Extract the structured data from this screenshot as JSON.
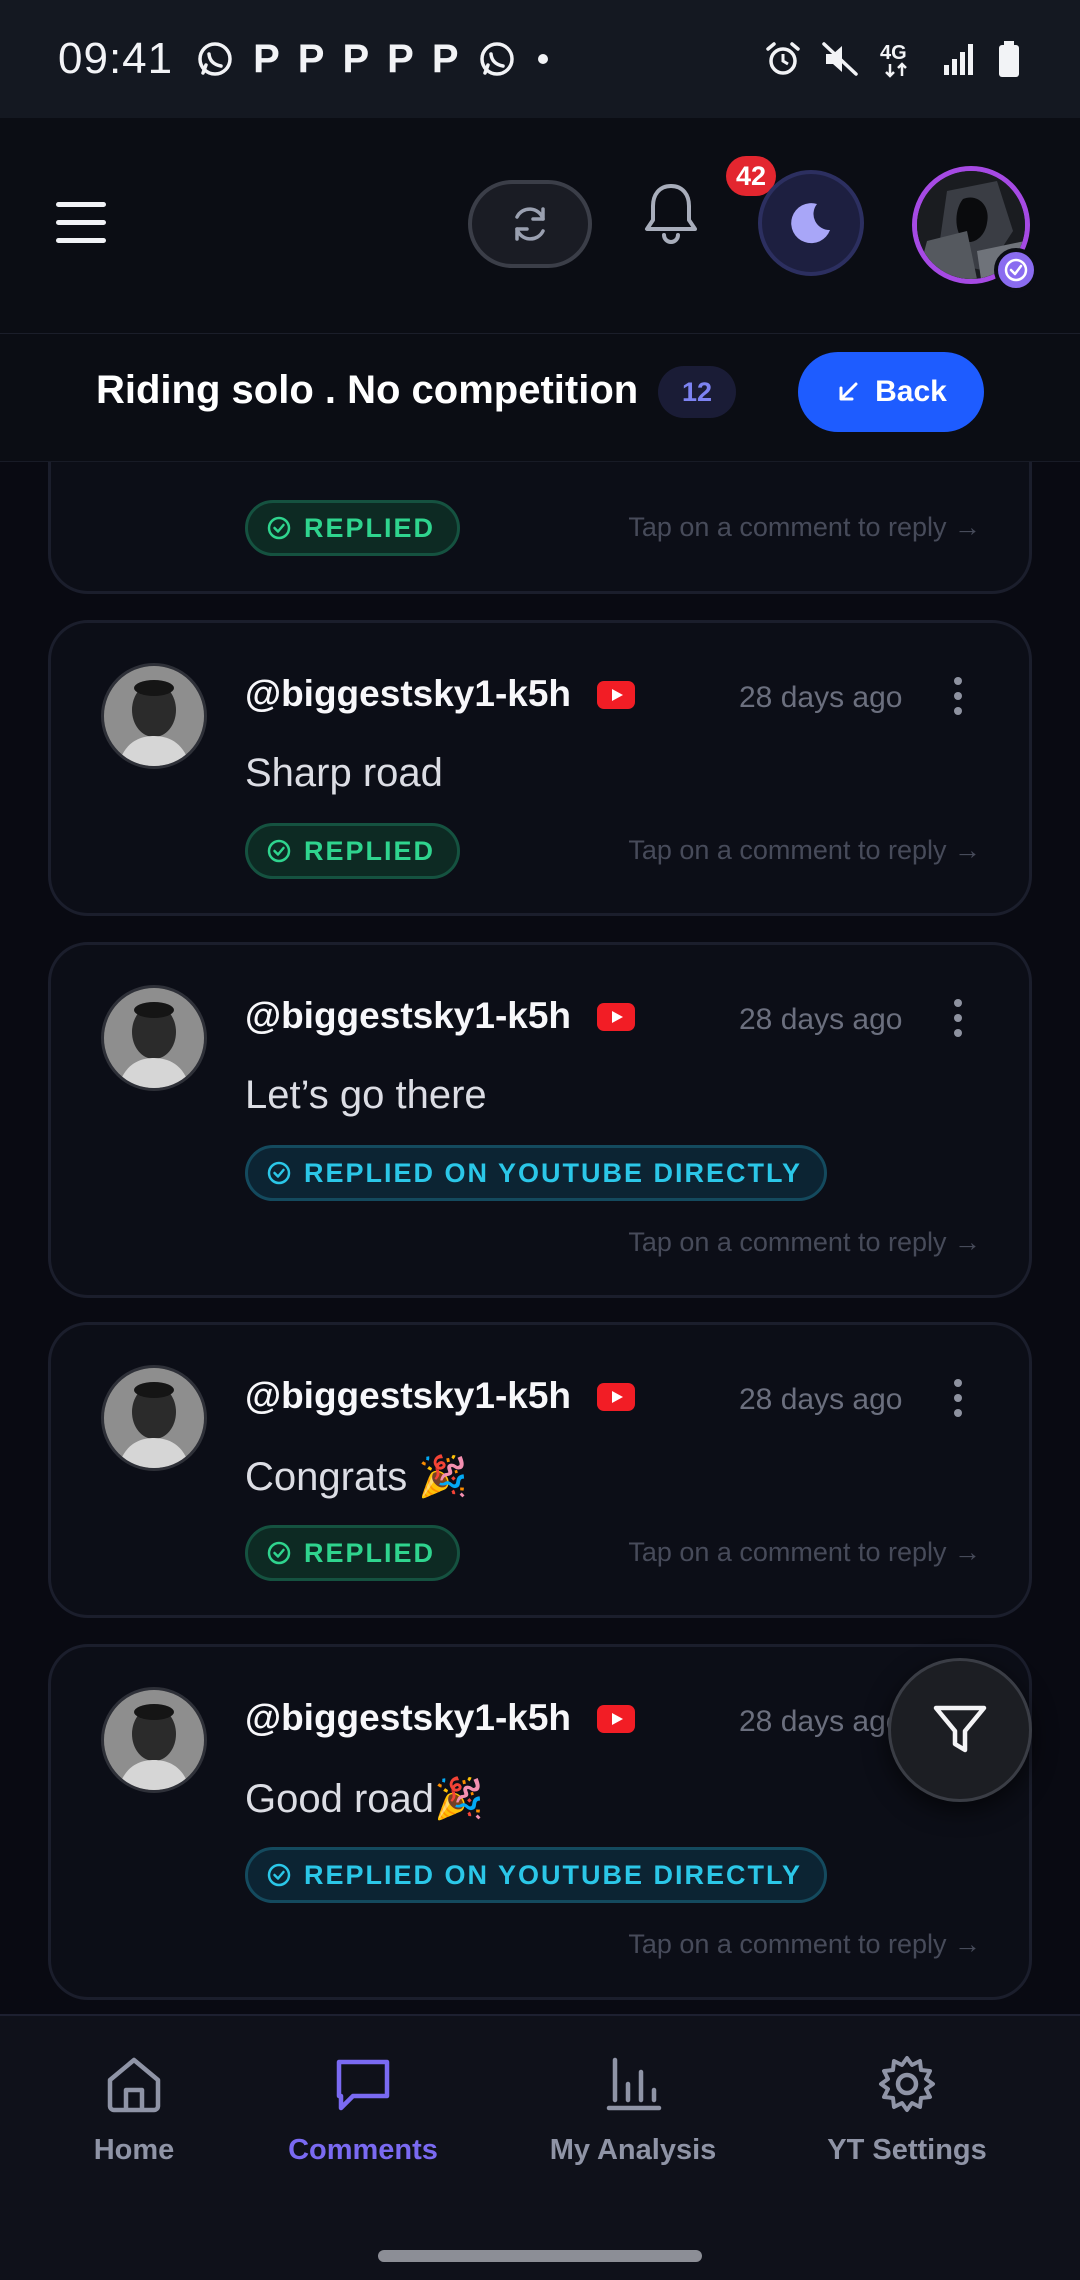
{
  "status_bar": {
    "time": "09:41",
    "notification_icons": [
      "whatsapp-icon",
      "p-icon",
      "p-icon",
      "p-icon",
      "p-icon",
      "p-icon",
      "whatsapp-icon",
      "dot-icon"
    ],
    "right_icons": [
      "alarm-icon",
      "mute-icon",
      "4g-icon",
      "signal-icon",
      "battery-icon"
    ],
    "p_glyph": "P",
    "network_label": "4G"
  },
  "header": {
    "notification_count": "42",
    "accent_purple": "#a64ae4"
  },
  "title_bar": {
    "title": "Riding solo . No competition",
    "count": "12",
    "back_label": "Back"
  },
  "partial_card": {
    "status": "REPLIED",
    "hint": "Tap on a comment to reply →"
  },
  "comments": [
    {
      "username": "@biggestsky1-k5h",
      "time": "28 days ago",
      "text": "Sharp road",
      "status": "REPLIED",
      "status_type": "replied",
      "hint": "Tap on a comment to reply →"
    },
    {
      "username": "@biggestsky1-k5h",
      "time": "28 days ago",
      "text": "Let’s go there",
      "status": "REPLIED ON YOUTUBE DIRECTLY",
      "status_type": "youtube",
      "hint": "Tap on a comment to reply →"
    },
    {
      "username": "@biggestsky1-k5h",
      "time": "28 days ago",
      "text": "Congrats 🎉",
      "status": "REPLIED",
      "status_type": "replied",
      "hint": "Tap on a comment to reply →"
    },
    {
      "username": "@biggestsky1-k5h",
      "time": "28 days ago",
      "text": "Good road🎉",
      "status": "REPLIED ON YOUTUBE DIRECTLY",
      "status_type": "youtube",
      "hint": "Tap on a comment to reply →"
    }
  ],
  "bottom_nav": {
    "items": [
      {
        "label": "Home",
        "icon": "home-icon",
        "active": false
      },
      {
        "label": "Comments",
        "icon": "comment-icon",
        "active": true
      },
      {
        "label": "My Analysis",
        "icon": "bar-chart-icon",
        "active": false
      },
      {
        "label": "YT Settings",
        "icon": "gear-icon",
        "active": false
      }
    ]
  },
  "colors": {
    "background": "#090a12",
    "primary_blue": "#1e5cff",
    "active_nav": "#7a6af2",
    "replied_green": "#2fd48e",
    "youtube_cyan": "#2bc7e8",
    "badge_red": "#e3262f"
  }
}
